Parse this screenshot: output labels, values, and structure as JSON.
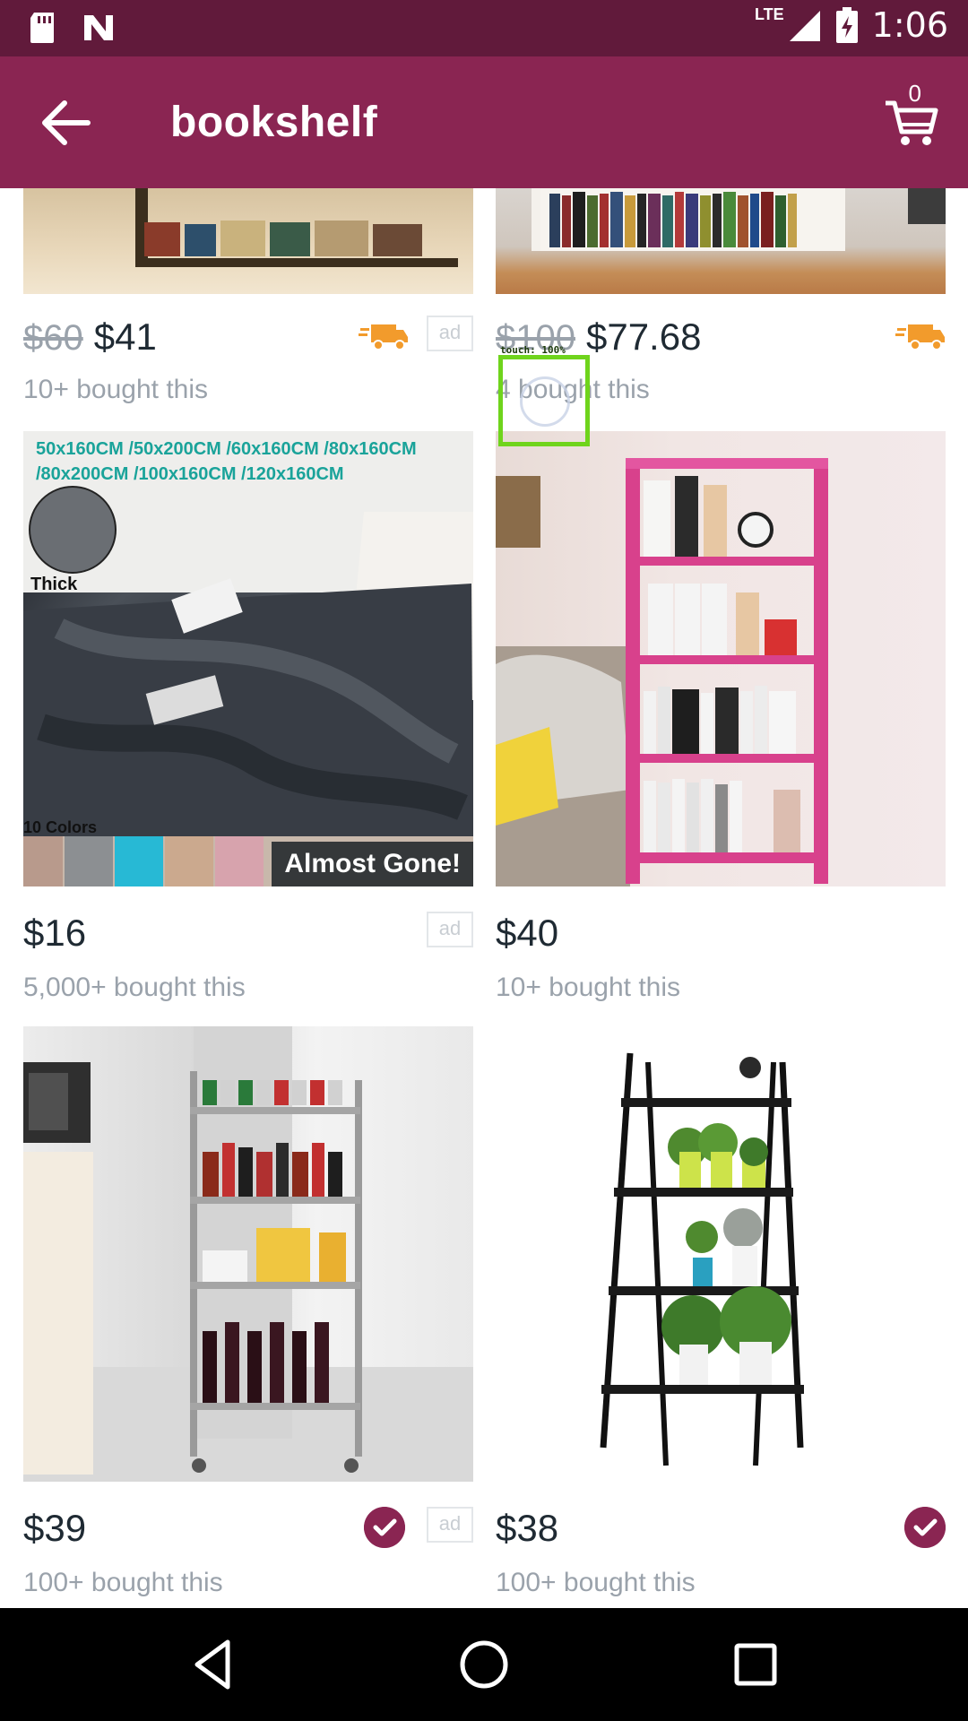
{
  "status_bar": {
    "time": "1:06",
    "network": "LTE",
    "icons": [
      "sd-card-icon",
      "n-icon",
      "signal-icon",
      "battery-charging-icon"
    ]
  },
  "app_bar": {
    "title": "bookshelf",
    "cart_count": "0"
  },
  "products": [
    {
      "old_price": "$60",
      "price": "$41",
      "bought": "10+ bought this",
      "ad": "ad",
      "badge": "fast-shipping-truck-icon"
    },
    {
      "old_price": "$100",
      "price": "$77.68",
      "bought": "4 bought this",
      "ad": "",
      "badge": "fast-shipping-truck-icon"
    },
    {
      "old_price": "",
      "price": "$16",
      "bought": "5,000+ bought this",
      "ad": "ad",
      "image_caption": "Almost Gone!",
      "image_text": [
        "50x160CM /50x200CM /60x160CM /80x160CM",
        "/80x200CM /100x160CM /120x160CM",
        "Thick",
        "10 Colors"
      ]
    },
    {
      "old_price": "",
      "price": "$40",
      "bought": "10+ bought this",
      "ad": ""
    },
    {
      "old_price": "",
      "price": "$39",
      "bought": "100+ bought this",
      "ad": "ad",
      "badge": "verified-check-icon"
    },
    {
      "old_price": "",
      "price": "$38",
      "bought": "100+ bought this",
      "ad": "",
      "badge": "verified-check-icon"
    }
  ],
  "touch_overlay": {
    "label": "touch: 100%"
  },
  "colors": {
    "status_bar": "#611a3b",
    "app_bar": "#8a2552",
    "price_text": "#1f2a33",
    "muted_text": "#9aa2ab",
    "truck": "#f29b2c",
    "verified": "#8a2552"
  }
}
